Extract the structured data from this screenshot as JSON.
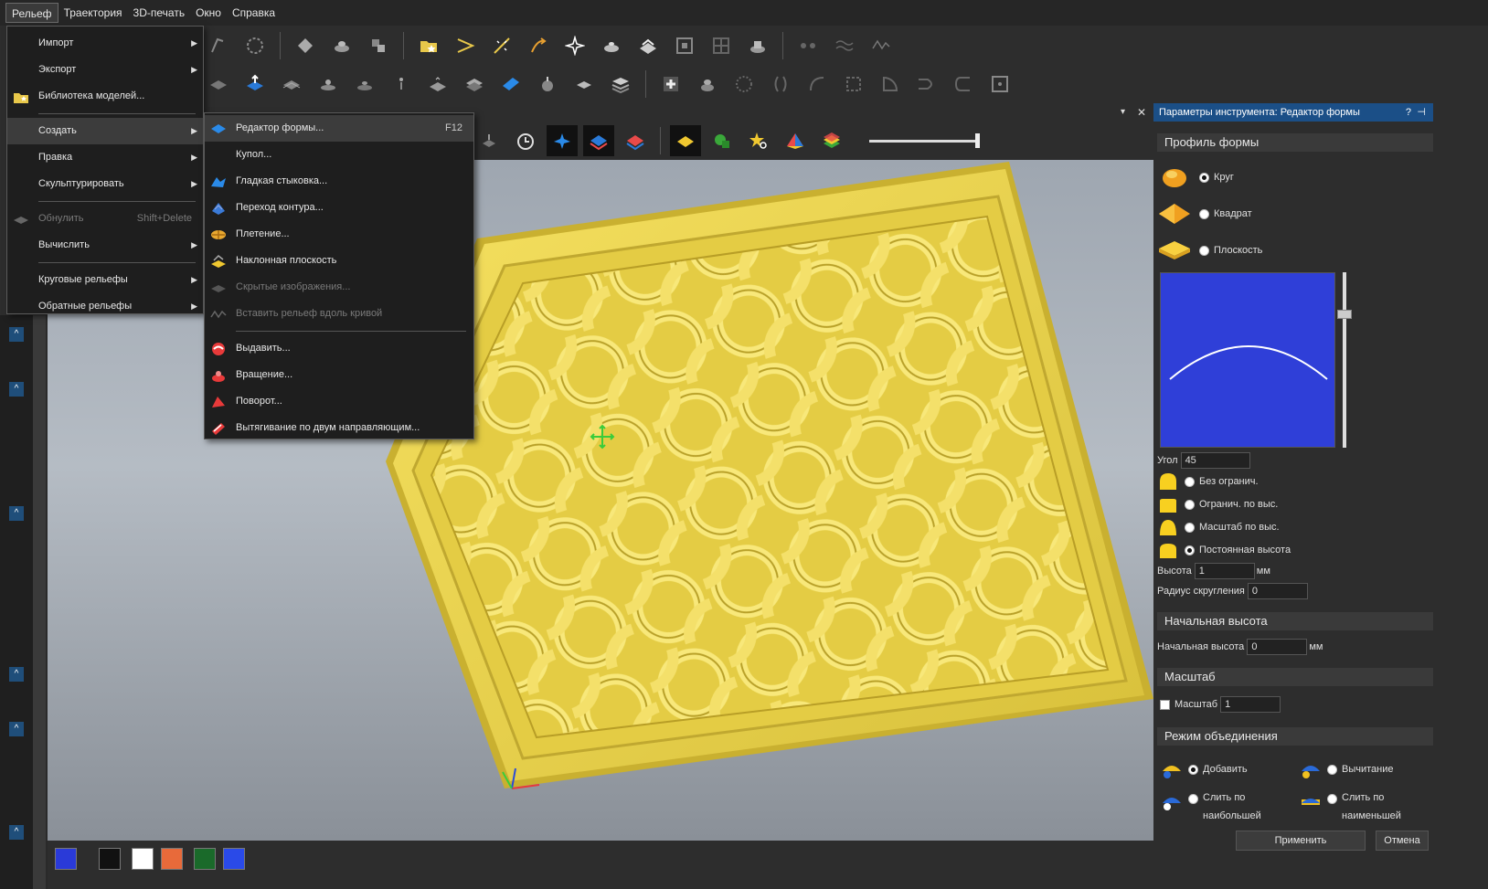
{
  "menubar": {
    "items": [
      "Рельеф",
      "Траектория",
      "3D-печать",
      "Окно",
      "Справка"
    ]
  },
  "main_menu": {
    "items": [
      {
        "label": "Импорт",
        "arrow": "▶"
      },
      {
        "label": "Экспорт",
        "arrow": "▶"
      },
      {
        "label": "Библиотека моделей...",
        "icon": "model-library-icon"
      },
      {
        "label": "Создать",
        "arrow": "▶"
      },
      {
        "label": "Правка",
        "arrow": "▶"
      },
      {
        "label": "Скульптурировать",
        "arrow": "▶"
      },
      {
        "label": "Обнулить",
        "shortcut": "Shift+Delete",
        "icon": "reset-icon"
      },
      {
        "label": "Вычислить",
        "arrow": "▶"
      },
      {
        "label": "Круговые рельефы",
        "arrow": "▶"
      },
      {
        "label": "Обратные рельефы",
        "arrow": "▶"
      }
    ]
  },
  "submenu": {
    "items": [
      {
        "label": "Редактор формы...",
        "shortcut": "F12",
        "icon": "shape-editor-icon"
      },
      {
        "label": "Купол..."
      },
      {
        "label": "Гладкая стыковка...",
        "icon": "smooth-join-icon"
      },
      {
        "label": "Переход контура...",
        "icon": "contour-transition-icon"
      },
      {
        "label": "Плетение...",
        "icon": "weave-icon"
      },
      {
        "label": "Наклонная плоскость",
        "icon": "inclined-plane-icon"
      },
      {
        "label": "Скрытые изображения...",
        "icon": "hidden-images-icon"
      },
      {
        "label": "Вставить рельеф вдоль кривой",
        "icon": "relief-along-curve-icon"
      },
      {
        "label": "Выдавить...",
        "icon": "extrude-icon"
      },
      {
        "label": "Вращение...",
        "icon": "spin-icon"
      },
      {
        "label": "Поворот...",
        "icon": "turn-icon"
      },
      {
        "label": "Вытягивание по двум направляющим...",
        "icon": "two-rail-sweep-icon"
      }
    ]
  },
  "panel": {
    "title": "Параметры инструмента: Редактор формы",
    "help": "?",
    "pin": "⊣",
    "close": "✕",
    "collapse": "▾",
    "profile_section": "Профиль формы",
    "profile_options": [
      "Круг",
      "Квадрат",
      "Плоскость"
    ],
    "angle_label": "Угол",
    "angle_value": "45",
    "limit_options": [
      "Без огранич.",
      "Огранич. по выс.",
      "Масштаб по выс.",
      "Постоянная высота"
    ],
    "height_label": "Высота",
    "height_value": "1",
    "height_unit": "мм",
    "radius_label": "Радиус скругления",
    "radius_value": "0",
    "start_section": "Начальная высота",
    "start_label": "Начальная высота",
    "start_value": "0",
    "start_unit": "мм",
    "scale_section": "Масштаб",
    "scale_label": "Масштаб",
    "scale_value": "1",
    "combine_section": "Режим объединения",
    "combine_add": "Добавить",
    "combine_subtract": "Вычитание",
    "combine_merge_high": "Слить по наибольшей",
    "combine_merge_low": "Слить по наименьшей",
    "apply": "Применить",
    "cancel": "Отмена"
  },
  "colors": {
    "accent": "#1b4f87",
    "relief": "#e8d24a",
    "preview_bg": "#2f3fd8"
  }
}
